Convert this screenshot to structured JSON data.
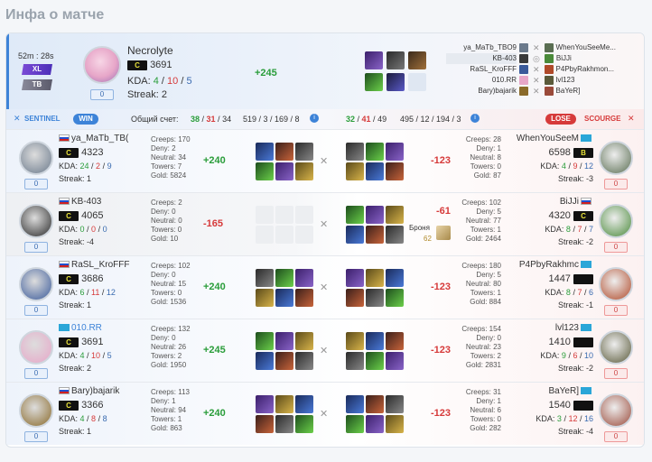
{
  "page_title": "Инфа о матче",
  "summary": {
    "duration": "52m : 28s",
    "mode_badge": "XL",
    "type_badge": "TB",
    "player": "Necrolyte",
    "rank": "C",
    "rating": "3691",
    "kda_label": "KDA:",
    "kills": "4",
    "deaths": "10",
    "assists": "5",
    "streak": "Streak: 2",
    "delta": "+245",
    "level": "0",
    "matchups": [
      {
        "left": "ya_MaTb_TBO9",
        "right": "WhenYouSeeMe..."
      },
      {
        "left": "KB-403",
        "right": "BiJJi"
      },
      {
        "left": "RaSL_KroFFF",
        "right": "P4PbyRakhmon..."
      },
      {
        "left": "010.RR",
        "right": "lvl123"
      },
      {
        "left": "Bary)bajarik",
        "right": "BaYeR]"
      }
    ]
  },
  "teams": {
    "sentinel_label": "SENTINEL",
    "win_label": "WIN",
    "score_label": "Общий счет:",
    "s_kills": "38",
    "s_deaths": "31",
    "s_assists": "34",
    "s_stats": "519 / 3 / 169 / 8",
    "c_kills": "32",
    "c_deaths": "41",
    "c_assists": "49",
    "c_stats": "495 / 12 / 194 / 3",
    "lose_label": "LOSE",
    "scourge_label": "SCOURGE"
  },
  "rows": [
    {
      "l_name": "ya_MaTb_TB(",
      "l_rank": "C",
      "l_rating": "4323",
      "l_k": "24",
      "l_d": "2",
      "l_a": "9",
      "l_streak": "Streak: 1",
      "l_level": "0",
      "l_creeps": "Creeps: 170",
      "l_deny": "Deny: 2",
      "l_neutral": "Neutral: 34",
      "l_towers": "Towers: 7",
      "l_gold": "Gold: 5824",
      "l_delta": "+240",
      "r_name": "WhenYouSeeM",
      "r_rank": "B",
      "r_rating": "6598",
      "r_k": "4",
      "r_d": "9",
      "r_a": "12",
      "r_streak": "Streak: -3",
      "r_level": "0",
      "r_creeps": "Creeps: 28",
      "r_deny": "Deny: 1",
      "r_neutral": "Neutral: 8",
      "r_towers": "Towers: 0",
      "r_gold": "Gold: 87",
      "r_delta": "-123"
    },
    {
      "l_name": "KB-403",
      "l_rank": "C",
      "l_rating": "4065",
      "l_k": "0",
      "l_d": "0",
      "l_a": "0",
      "l_streak": "Streak: -4",
      "l_level": "0",
      "l_creeps": "Creeps: 2",
      "l_deny": "Deny: 0",
      "l_neutral": "Neutral: 0",
      "l_towers": "Towers: 0",
      "l_gold": "Gold: 10",
      "l_delta": "-165",
      "r_name": "BiJJi",
      "r_rank": "C",
      "r_rating": "4320",
      "r_k": "8",
      "r_d": "7",
      "r_a": "7",
      "r_streak": "Streak: -2",
      "r_level": "0",
      "r_creeps": "Creeps: 102",
      "r_deny": "Deny: 5",
      "r_neutral": "Neutral: 77",
      "r_towers": "Towers: 1",
      "r_gold": "Gold: 2464",
      "r_delta": "-61",
      "armor_label": "Броня",
      "armor_val": "62"
    },
    {
      "l_name": "RaSL_KroFFF",
      "l_rank": "C",
      "l_rating": "3686",
      "l_k": "6",
      "l_d": "11",
      "l_a": "12",
      "l_streak": "Streak: 1",
      "l_level": "0",
      "l_creeps": "Creeps: 102",
      "l_deny": "Deny: 0",
      "l_neutral": "Neutral: 15",
      "l_towers": "Towers: 0",
      "l_gold": "Gold: 1536",
      "l_delta": "+240",
      "r_name": "P4PbyRakhmc",
      "r_rank": "",
      "r_rating": "1447",
      "r_k": "8",
      "r_d": "7",
      "r_a": "6",
      "r_streak": "Streak: -1",
      "r_level": "0",
      "r_creeps": "Creeps: 180",
      "r_deny": "Deny: 5",
      "r_neutral": "Neutral: 80",
      "r_towers": "Towers: 1",
      "r_gold": "Gold: 884",
      "r_delta": "-123"
    },
    {
      "l_name": "010.RR",
      "l_rank": "C",
      "l_rating": "3691",
      "l_k": "4",
      "l_d": "10",
      "l_a": "5",
      "l_streak": "Streak: 2",
      "l_level": "0",
      "l_creeps": "Creeps: 132",
      "l_deny": "Deny: 0",
      "l_neutral": "Neutral: 26",
      "l_towers": "Towers: 2",
      "l_gold": "Gold: 1950",
      "l_delta": "+245",
      "r_name": "lvl123",
      "r_rank": "",
      "r_rating": "1410",
      "r_k": "9",
      "r_d": "6",
      "r_a": "10",
      "r_streak": "Streak: -2",
      "r_level": "0",
      "r_creeps": "Creeps: 154",
      "r_deny": "Deny: 0",
      "r_neutral": "Neutral: 23",
      "r_towers": "Towers: 2",
      "r_gold": "Gold: 2831",
      "r_delta": "-123"
    },
    {
      "l_name": "Bary)bajarik",
      "l_rank": "C",
      "l_rating": "3366",
      "l_k": "4",
      "l_d": "8",
      "l_a": "8",
      "l_streak": "Streak: 1",
      "l_level": "0",
      "l_creeps": "Creeps: 113",
      "l_deny": "Deny: 1",
      "l_neutral": "Neutral: 94",
      "l_towers": "Towers: 1",
      "l_gold": "Gold: 863",
      "l_delta": "+240",
      "r_name": "BaYeR]",
      "r_rank": "",
      "r_rating": "1540",
      "r_k": "3",
      "r_d": "12",
      "r_a": "16",
      "r_streak": "Streak: -4",
      "r_level": "0",
      "r_creeps": "Creeps: 31",
      "r_deny": "Deny: 1",
      "r_neutral": "Neutral: 6",
      "r_towers": "Towers: 0",
      "r_gold": "Gold: 282",
      "r_delta": "-123"
    }
  ],
  "colors": {
    "accent": "#3d83d8",
    "win": "#2a9d3a",
    "lose": "#d63a3a"
  }
}
